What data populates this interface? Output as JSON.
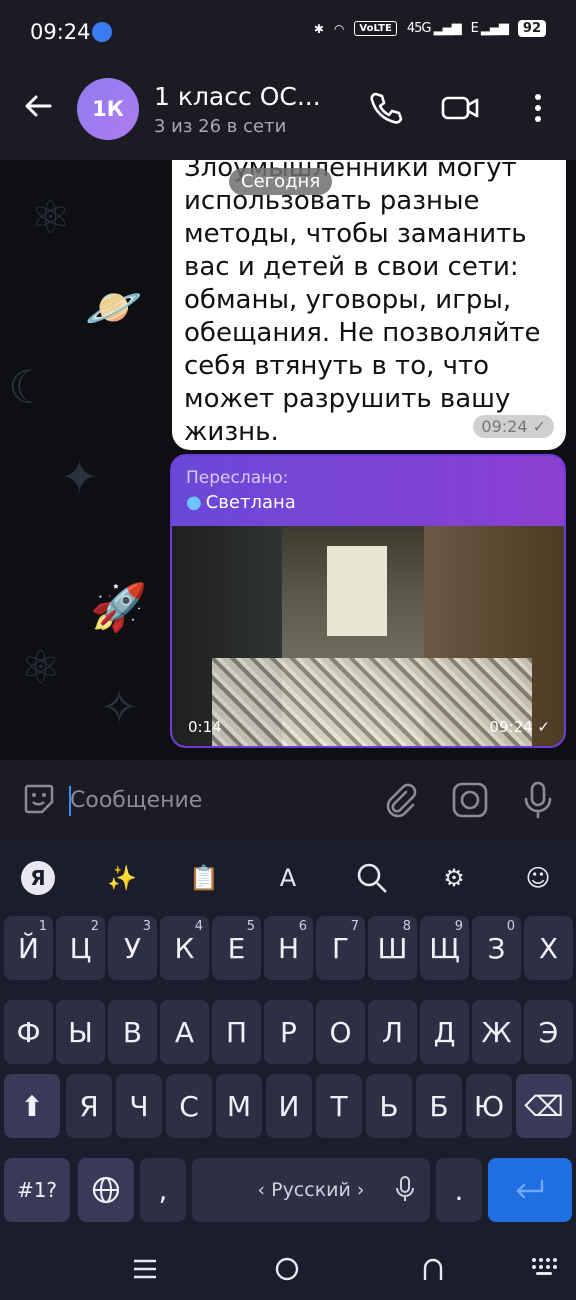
{
  "status_bar": {
    "time": "09:24",
    "volte": "VoLTE",
    "sig1": "45G",
    "sig2": "E",
    "battery": "92"
  },
  "header": {
    "avatar_initials": "1К",
    "title": "1 класс ОС...",
    "subtitle": "3 из 26 в сети"
  },
  "messages": {
    "date_chip": "Сегодня",
    "text_message": {
      "text": "Злоумышленники могут использовать разные методы, чтобы заманить вас и детей в свои сети: обманы, уговоры, игры, обещания. Не позволяйте себя втянуть в то, что может разрушить вашу жизнь.",
      "time": "09:24 ✓"
    },
    "forwarded_video": {
      "forwarded_label": "Переслано:",
      "forwarded_from": "Светлана",
      "duration": "0:14",
      "time": "09:24 ✓"
    }
  },
  "input": {
    "placeholder": "Сообщение"
  },
  "keyboard": {
    "row1": [
      {
        "k": "Й",
        "s": "1"
      },
      {
        "k": "Ц",
        "s": "2"
      },
      {
        "k": "У",
        "s": "3"
      },
      {
        "k": "К",
        "s": "4"
      },
      {
        "k": "Е",
        "s": "5"
      },
      {
        "k": "Н",
        "s": "6"
      },
      {
        "k": "Г",
        "s": "7"
      },
      {
        "k": "Ш",
        "s": "8"
      },
      {
        "k": "Щ",
        "s": "9"
      },
      {
        "k": "З",
        "s": "0"
      },
      {
        "k": "Х",
        "s": ""
      }
    ],
    "row2": [
      "Ф",
      "Ы",
      "В",
      "А",
      "П",
      "Р",
      "О",
      "Л",
      "Д",
      "Ж",
      "Э"
    ],
    "row3": [
      "Я",
      "Ч",
      "С",
      "М",
      "И",
      "Т",
      "Ь",
      "Б",
      "Ю"
    ],
    "symbols_label": "#1?",
    "comma": ",",
    "space_label": "‹ Русский ›",
    "period": ".",
    "yandex_label": "Я"
  }
}
